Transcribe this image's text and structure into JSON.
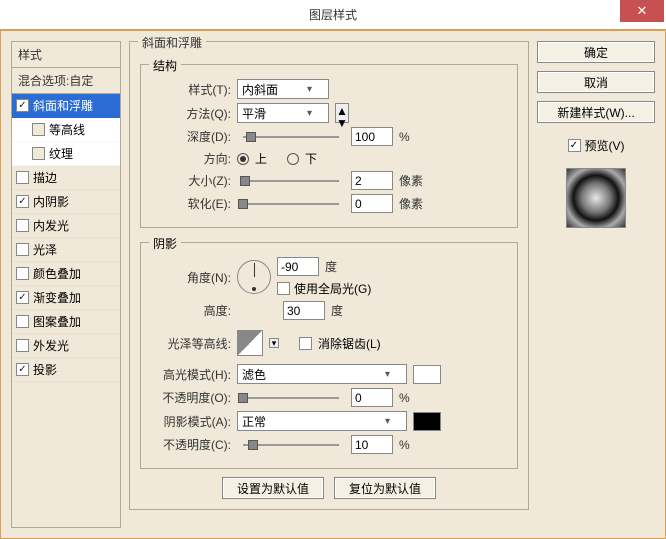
{
  "title": "图层样式",
  "sidebar": {
    "header": "样式",
    "subheader": "混合选项:自定",
    "items": [
      {
        "label": "斜面和浮雕",
        "checked": true,
        "selected": true
      },
      {
        "label": "等高线",
        "checked": false,
        "sub": true
      },
      {
        "label": "纹理",
        "checked": false,
        "sub": true
      },
      {
        "label": "描边",
        "checked": false
      },
      {
        "label": "内阴影",
        "checked": true
      },
      {
        "label": "内发光",
        "checked": false
      },
      {
        "label": "光泽",
        "checked": false
      },
      {
        "label": "颜色叠加",
        "checked": false
      },
      {
        "label": "渐变叠加",
        "checked": true
      },
      {
        "label": "图案叠加",
        "checked": false
      },
      {
        "label": "外发光",
        "checked": false
      },
      {
        "label": "投影",
        "checked": true
      }
    ]
  },
  "panel": {
    "title": "斜面和浮雕",
    "structure": {
      "legend": "结构",
      "style_label": "样式(T):",
      "style_value": "内斜面",
      "method_label": "方法(Q):",
      "method_value": "平滑",
      "depth_label": "深度(D):",
      "depth_value": "100",
      "depth_unit": "%",
      "direction_label": "方向:",
      "up_label": "上",
      "down_label": "下",
      "size_label": "大小(Z):",
      "size_value": "2",
      "size_unit": "像素",
      "soften_label": "软化(E):",
      "soften_value": "0",
      "soften_unit": "像素"
    },
    "shading": {
      "legend": "阴影",
      "angle_label": "角度(N):",
      "angle_value": "-90",
      "angle_unit": "度",
      "global_label": "使用全局光(G)",
      "altitude_label": "高度:",
      "altitude_value": "30",
      "altitude_unit": "度",
      "gloss_label": "光泽等高线:",
      "antialias_label": "消除锯齿(L)",
      "highlight_mode_label": "高光模式(H):",
      "highlight_mode_value": "滤色",
      "highlight_color": "#ffffff",
      "opacity_label": "不透明度(O):",
      "opacity_value": "0",
      "opacity_unit": "%",
      "shadow_mode_label": "阴影模式(A):",
      "shadow_mode_value": "正常",
      "shadow_color": "#000000",
      "opacity2_label": "不透明度(C):",
      "opacity2_value": "10",
      "opacity2_unit": "%"
    },
    "default_btn": "设置为默认值",
    "reset_btn": "复位为默认值"
  },
  "right": {
    "ok": "确定",
    "cancel": "取消",
    "newstyle": "新建样式(W)...",
    "preview_label": "预览(V)"
  }
}
